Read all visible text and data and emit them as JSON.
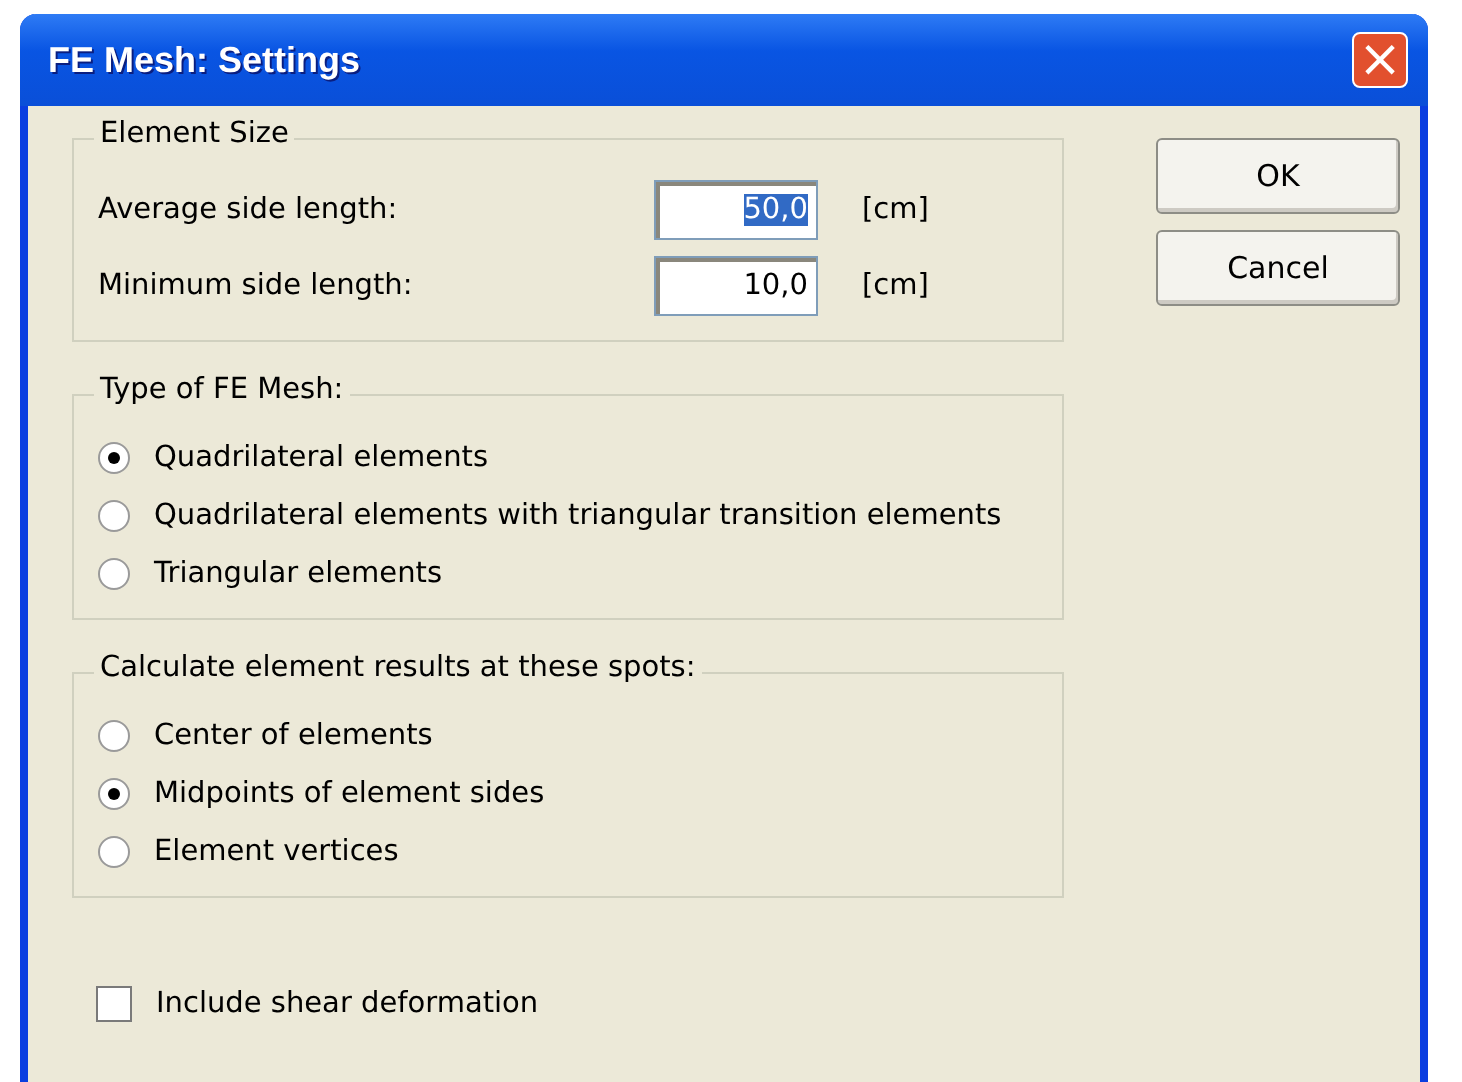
{
  "window": {
    "title": "FE Mesh: Settings",
    "close_button": "×"
  },
  "element_size": {
    "title": "Element Size",
    "fields": [
      {
        "label": "Average side length:",
        "value": "50,0",
        "unit": "[cm]",
        "highlighted": true
      },
      {
        "label": "Minimum side length:",
        "value": "10,0",
        "unit": "[cm]",
        "highlighted": false
      }
    ]
  },
  "mesh_type": {
    "title": "Type of FE Mesh:",
    "options": [
      {
        "label": "Quadrilateral elements",
        "selected": true
      },
      {
        "label": "Quadrilateral elements with triangular transition elements",
        "selected": false
      },
      {
        "label": "Triangular elements",
        "selected": false
      }
    ]
  },
  "result_spots": {
    "title": "Calculate element results at these spots:",
    "options": [
      {
        "label": "Center of elements",
        "selected": false
      },
      {
        "label": "Midpoints of element sides",
        "selected": true
      },
      {
        "label": "Element vertices",
        "selected": false
      }
    ]
  },
  "shear_deformation": {
    "label": "Include shear deformation",
    "checked": false
  },
  "buttons": [
    "OK",
    "Cancel"
  ]
}
